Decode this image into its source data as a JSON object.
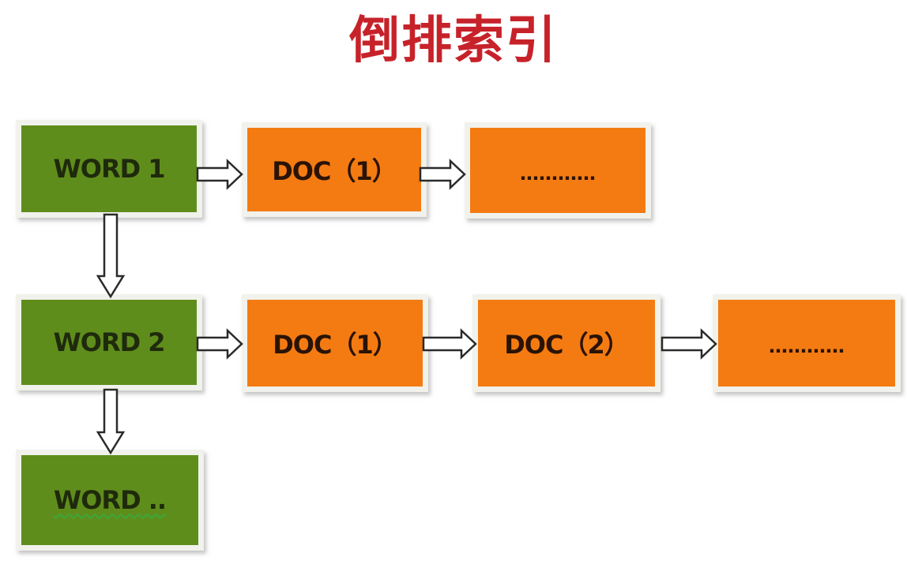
{
  "title": "倒排索引",
  "rows": [
    {
      "word": "WORD 1",
      "postings": [
        "DOC（1）",
        "…………"
      ]
    },
    {
      "word": "WORD 2",
      "postings": [
        "DOC（1）",
        "DOC（2）",
        "…………"
      ]
    },
    {
      "word": "WORD ..",
      "postings": []
    }
  ],
  "colors": {
    "title": "#c7222a",
    "word_box": "#5f8d1c",
    "doc_box": "#f47b12",
    "box_border": "#f1f2ec"
  }
}
